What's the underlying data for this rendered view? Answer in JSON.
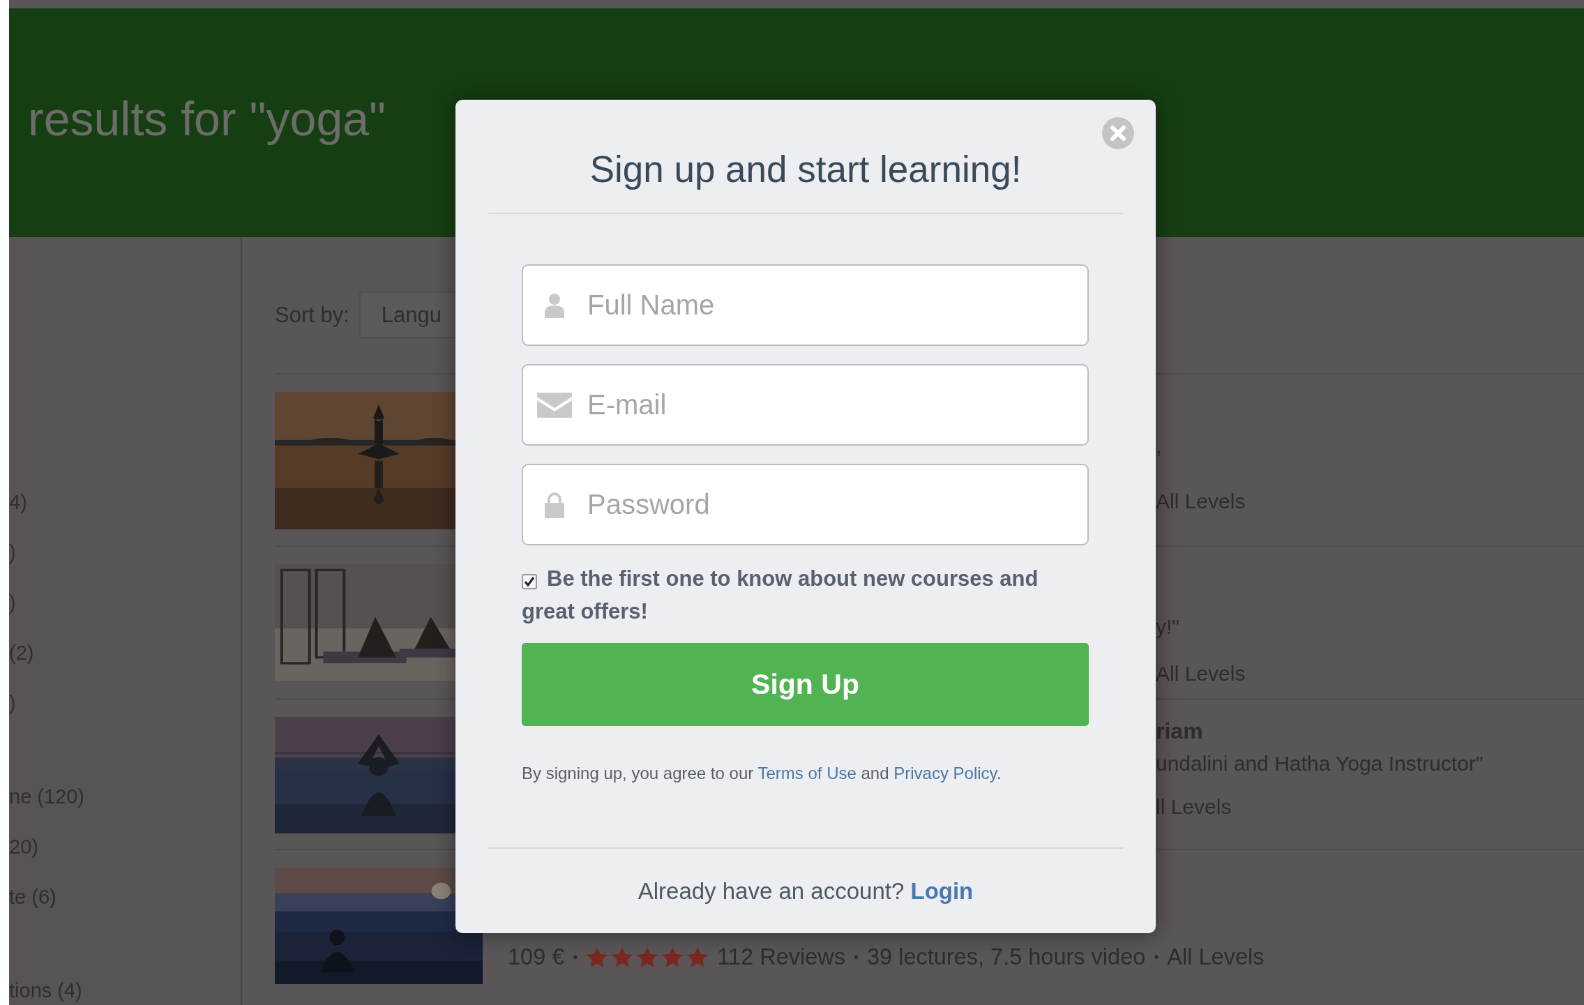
{
  "header": {
    "title": "results for \"yoga\""
  },
  "sidebar": {
    "groups": [
      {
        "items": [
          "4)",
          ")",
          ")",
          "(2)",
          ")"
        ]
      },
      {
        "items": [
          "ne (120)",
          "20)",
          "te (6)"
        ]
      },
      {
        "items": [
          "tions (4)"
        ]
      }
    ]
  },
  "sort": {
    "label": "Sort by:",
    "value": "Langu"
  },
  "courses": [
    {
      "kind": "behind-dialog",
      "title": ",",
      "level": "All Levels"
    },
    {
      "kind": "behind-dialog",
      "title": "y!\"",
      "level": "All Levels"
    },
    {
      "kind": "behind-dialog",
      "title": "riam",
      "subtitle": "undalini and Hatha Yoga Instructor\"",
      "level": "ll Levels"
    },
    {
      "kind": "full",
      "meta": {
        "price": "109 €",
        "stars": 5,
        "reviews": "112 Reviews",
        "details": "39 lectures, 7.5 hours video",
        "level": "All Levels",
        "separators": [
          "•",
          "•",
          "•"
        ]
      }
    }
  ],
  "dialog": {
    "title": "Sign up and start learning!",
    "fields": [
      {
        "kind": "name",
        "placeholder": "Full Name"
      },
      {
        "kind": "email",
        "placeholder": "E-mail"
      },
      {
        "kind": "password",
        "placeholder": "Password"
      }
    ],
    "newsletter": {
      "checked": true,
      "label": "Be the first one to know about new courses and great offers!"
    },
    "button": "Sign Up",
    "terms": [
      {
        "text": "By signing up, you agree to our "
      },
      {
        "link": "Terms of Use"
      },
      {
        "text": " and "
      },
      {
        "link": "Privacy Policy"
      },
      {
        "text": "."
      }
    ],
    "footer": [
      {
        "text": "Already have an account? "
      },
      {
        "link": "Login"
      }
    ]
  }
}
